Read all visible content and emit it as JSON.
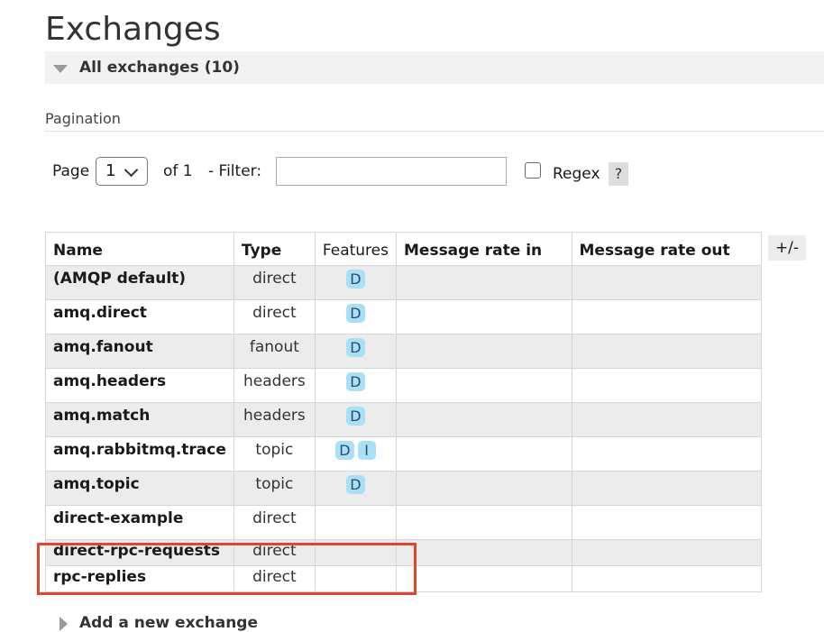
{
  "page": {
    "title": "Exchanges"
  },
  "section": {
    "label": "All exchanges (10)"
  },
  "pagination": {
    "heading": "Pagination",
    "page_label": "Page",
    "page_value": "1",
    "of_label": "of 1",
    "filter_label": "- Filter:",
    "filter_value": "",
    "regex_label": "Regex",
    "help_label": "?"
  },
  "table": {
    "columns": [
      "Name",
      "Type",
      "Features",
      "Message rate in",
      "Message rate out"
    ],
    "toggle_label": "+/-",
    "rows": [
      {
        "name": "(AMQP default)",
        "type": "direct",
        "features": [
          "D"
        ],
        "rate_in": "",
        "rate_out": ""
      },
      {
        "name": "amq.direct",
        "type": "direct",
        "features": [
          "D"
        ],
        "rate_in": "",
        "rate_out": ""
      },
      {
        "name": "amq.fanout",
        "type": "fanout",
        "features": [
          "D"
        ],
        "rate_in": "",
        "rate_out": ""
      },
      {
        "name": "amq.headers",
        "type": "headers",
        "features": [
          "D"
        ],
        "rate_in": "",
        "rate_out": ""
      },
      {
        "name": "amq.match",
        "type": "headers",
        "features": [
          "D"
        ],
        "rate_in": "",
        "rate_out": ""
      },
      {
        "name": "amq.rabbitmq.trace",
        "type": "topic",
        "features": [
          "D",
          "I"
        ],
        "rate_in": "",
        "rate_out": ""
      },
      {
        "name": "amq.topic",
        "type": "topic",
        "features": [
          "D"
        ],
        "rate_in": "",
        "rate_out": ""
      },
      {
        "name": "direct-example",
        "type": "direct",
        "features": [],
        "rate_in": "",
        "rate_out": ""
      },
      {
        "name": "direct-rpc-requests",
        "type": "direct",
        "features": [],
        "rate_in": "",
        "rate_out": ""
      },
      {
        "name": "rpc-replies",
        "type": "direct",
        "features": [],
        "rate_in": "",
        "rate_out": ""
      }
    ]
  },
  "add_exchange": {
    "label": "Add a new exchange"
  },
  "colors": {
    "badge_bg": "#a9e0f5",
    "highlight": "#e0452f",
    "row_alt": "#ececec"
  }
}
